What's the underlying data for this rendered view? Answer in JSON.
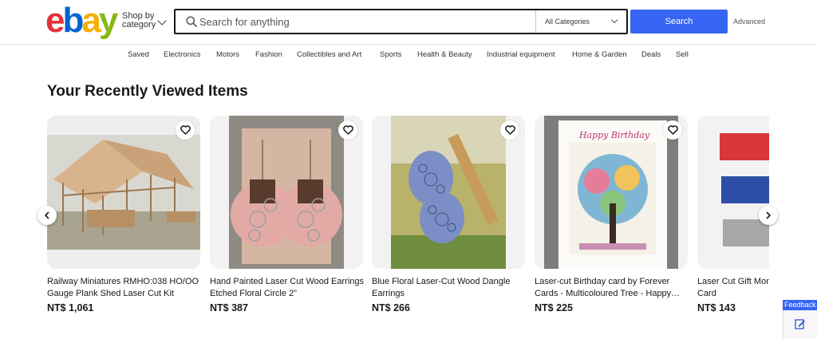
{
  "header": {
    "logo_letters": [
      {
        "char": "e",
        "color": "#e53238"
      },
      {
        "char": "b",
        "color": "#0064d2"
      },
      {
        "char": "a",
        "color": "#f5af02"
      },
      {
        "char": "y",
        "color": "#86b817"
      }
    ],
    "shop_by_line1": "Shop by",
    "shop_by_line2": "category",
    "search_placeholder": "Search for anything",
    "category_select": "All Categories",
    "search_button": "Search",
    "advanced_link": "Advanced"
  },
  "nav": {
    "items": [
      "Saved",
      "Electronics",
      "Motors",
      "Fashion",
      "Collectibles and Art",
      "Sports",
      "Health & Beauty",
      "Industrial equipment",
      "Home & Garden",
      "Deals",
      "Sell"
    ]
  },
  "recently_viewed": {
    "title": "Your Recently Viewed Items",
    "items": [
      {
        "title": "Railway Miniatures RMHO:038 HO/OO Gauge Plank Shed Laser Cut Kit",
        "price": "NT$ 1,061"
      },
      {
        "title": "Hand Painted Laser Cut Wood Earrings Etched Floral Circle 2\"",
        "price": "NT$ 387"
      },
      {
        "title": "Blue Floral Laser-Cut Wood Dangle Earrings",
        "price": "NT$ 266"
      },
      {
        "title": "Laser-cut Birthday card by Forever Cards - Multicoloured Tree - Happy…",
        "price": "NT$ 225"
      },
      {
        "title": "Laser Cut Gift Money Tokens Wallet Card",
        "price": "NT$ 143"
      }
    ],
    "card_texts": {
      "birthday_card_text": "Happy Birthday"
    }
  },
  "feedback": {
    "label": "Feedback"
  },
  "colors": {
    "accent": "#3665f3"
  }
}
